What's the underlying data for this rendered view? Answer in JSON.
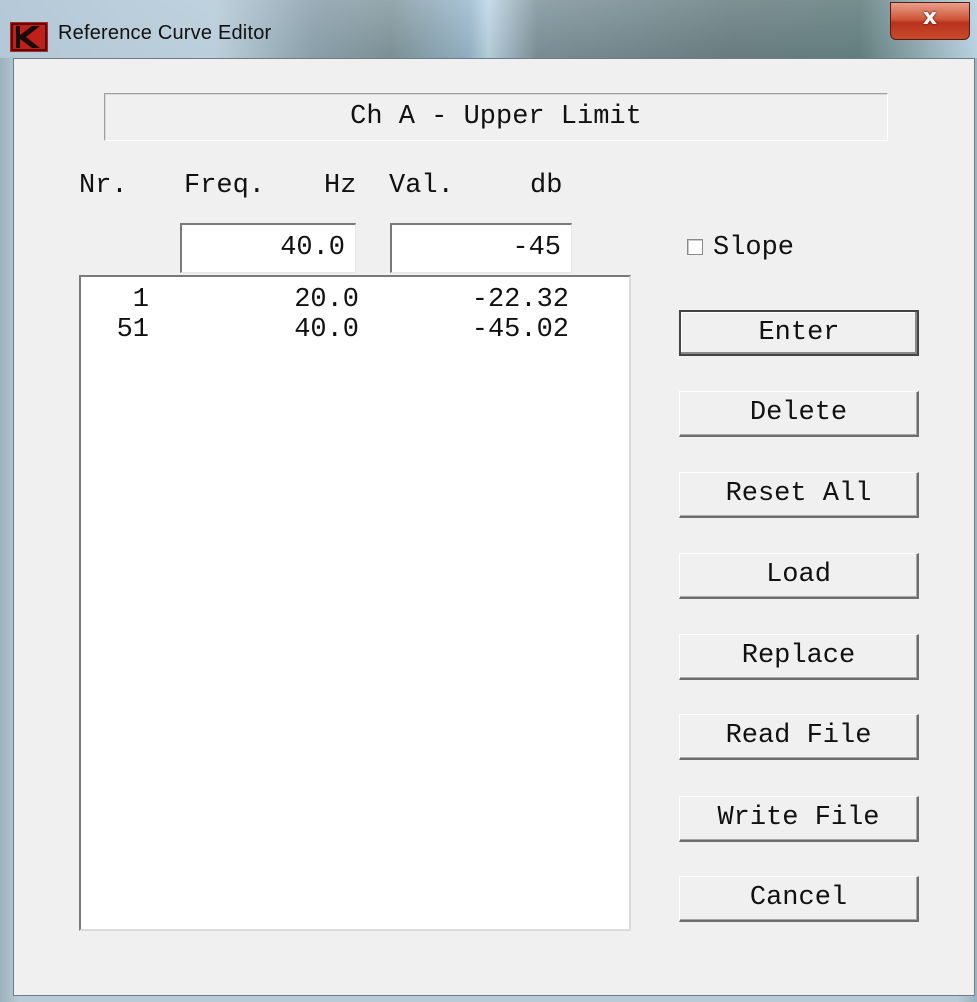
{
  "window": {
    "title": "Reference Curve Editor",
    "close_label": "x"
  },
  "header": {
    "channel_title": "Ch A - Upper Limit"
  },
  "columns": {
    "nr": "Nr.",
    "freq": "Freq.",
    "freq_unit": "Hz",
    "val": "Val.",
    "val_unit": "db"
  },
  "inputs": {
    "freq_value": "40.0",
    "val_value": "-45"
  },
  "slope": {
    "label": "Slope",
    "checked": false
  },
  "list": {
    "rows": [
      {
        "nr": "1",
        "freq": "20.0",
        "val": "-22.32"
      },
      {
        "nr": "51",
        "freq": "40.0",
        "val": "-45.02"
      }
    ]
  },
  "buttons": {
    "enter": "Enter",
    "delete": "Delete",
    "reset_all": "Reset All",
    "load": "Load",
    "replace": "Replace",
    "read_file": "Read File",
    "write_file": "Write File",
    "cancel": "Cancel"
  },
  "colors": {
    "client_bg": "#f0f0f0",
    "close_button": "#c8452a",
    "app_icon": "#c0201a"
  },
  "icons": {
    "app": "k-logo-icon",
    "close": "close-icon"
  }
}
